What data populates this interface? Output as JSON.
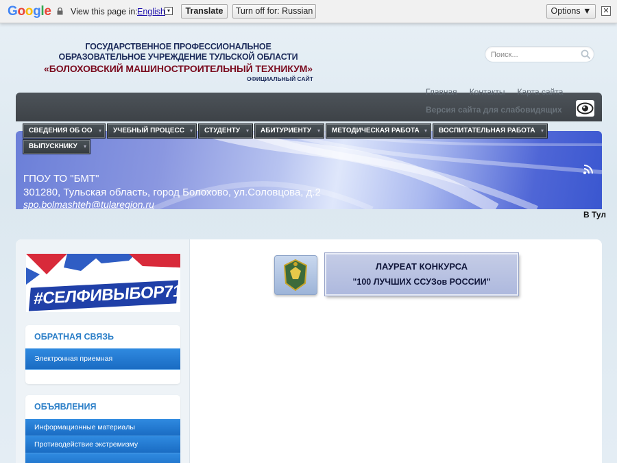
{
  "translate_bar": {
    "brand": "Google",
    "view_text": "View this page in:",
    "language": "English",
    "dropdown_glyph": "▾",
    "translate_label": "Translate",
    "turn_off_label": "Turn off for: Russian",
    "options_label": "Options ▼",
    "close_glyph": "✕"
  },
  "header": {
    "line1": "ГОСУДАРСТВЕННОЕ ПРОФЕССИОНАЛЬНОЕ",
    "line2": "ОБРАЗОВАТЕЛЬНОЕ УЧРЕЖДЕНИЕ ТУЛЬСКОЙ ОБЛАСТИ",
    "line3": "«БОЛОХОВСКИЙ МАШИНОСТРОИТЕЛЬНЫЙ ТЕХНИКУМ»",
    "subtitle": "ОФИЦИАЛЬНЫЙ САЙТ"
  },
  "search": {
    "placeholder": "Поиск..."
  },
  "top_links": [
    "Главная",
    "Контакты",
    "Карта сайта"
  ],
  "vision_link": "Версия сайта для слабовидящих",
  "menu": [
    "СВЕДЕНИЯ ОБ ОО",
    "УЧЕБНЫЙ ПРОЦЕСС",
    "СТУДЕНТУ",
    "АБИТУРИЕНТУ",
    "МЕТОДИЧЕСКАЯ РАБОТА",
    "ВОСПИТАТЕЛЬНАЯ РАБОТА",
    "ВЫПУСКНИКУ"
  ],
  "menu_caret": "▾",
  "banner": {
    "org": "ГПОУ ТО \"БМТ\"",
    "address": "301280, Тульская область, город Болохово, ул.Соловцова, д.2",
    "email": "spo.bolmashteh@tularegion.ru"
  },
  "ticker": "В Тул",
  "sidebar": {
    "selfie_banner": "#СЕЛФИВЫБОР71",
    "feedback": {
      "title": "ОБРАТНАЯ СВЯЗЬ",
      "items": [
        "Электронная приемная"
      ]
    },
    "announcements": {
      "title": "ОБЪЯВЛЕНИЯ",
      "items": [
        "Информационные материалы",
        "Противодействие экстремизму"
      ]
    }
  },
  "laureate": {
    "line1": "ЛАУРЕАТ КОНКУРСА",
    "line2": "\"100 ЛУЧШИХ ССУЗов  РОССИИ\""
  },
  "colors": {
    "accent_blue": "#2c7fc8",
    "title_navy": "#1c2b5a",
    "title_maroon": "#7a0a1e",
    "menu_dark": "#3d4247"
  }
}
